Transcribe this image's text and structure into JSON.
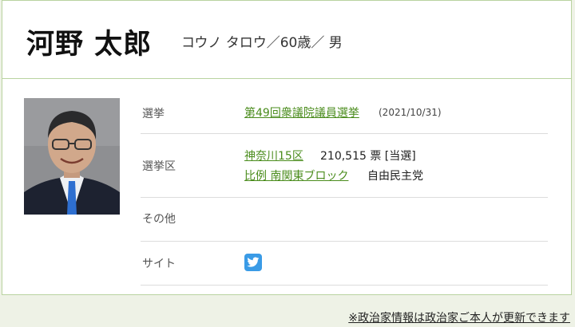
{
  "profile": {
    "name": "河野 太郎",
    "kana_age_gender": "コウノ タロウ／60歳／ 男"
  },
  "rows": {
    "election": {
      "label": "選挙",
      "link": "第49回衆議院議員選挙",
      "date": "(2021/10/31)"
    },
    "district": {
      "label": "選挙区",
      "district_link": "神奈川15区",
      "votes": "210,515 票 [当選]",
      "pr_link": "比例 南関東ブロック",
      "party": "自由民主党"
    },
    "other": {
      "label": "その他"
    },
    "site": {
      "label": "サイト",
      "icon": "twitter-icon"
    }
  },
  "footer": {
    "note": "※政治家情報は政治家ご本人が更新できます"
  },
  "colors": {
    "link": "#4a8c1c",
    "border": "#b9d3a0",
    "twitter": "#3a9be6"
  }
}
